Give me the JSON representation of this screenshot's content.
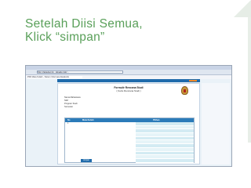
{
  "slide": {
    "title_line1": "Setelah Diisi Semua,",
    "title_line2": "Klick “simpan”"
  },
  "browser": {
    "address": "http://akademik.../akademik/...",
    "tab": "Pilih Mata Kuliah - Sistem Informasi Akademik"
  },
  "app": {
    "user_name": "",
    "header_line1": "Formulir Rencana Studi",
    "header_line2": "( Kartu Rencana Studi )",
    "info": [
      {
        "key": "Nama Mahasiswa",
        "value": ""
      },
      {
        "key": "NIM",
        "value": ""
      },
      {
        "key": "Program Studi",
        "value": ""
      },
      {
        "key": "Semester",
        "value": ""
      }
    ],
    "note": "",
    "columns": [
      "No",
      "Mata Kuliah",
      "Pilihan"
    ],
    "rows": [
      {
        "no": "1",
        "item": ""
      }
    ],
    "choices": [
      "",
      "",
      "",
      "",
      "",
      "",
      "",
      "",
      "",
      "",
      ""
    ],
    "save_label": "simpan"
  }
}
